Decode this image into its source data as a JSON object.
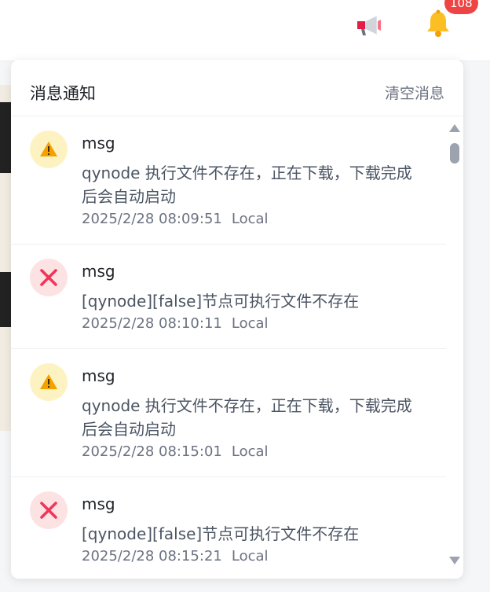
{
  "topbar": {
    "megaphone_icon": "megaphone-icon",
    "bell_icon": "bell-icon",
    "badge_count": "108"
  },
  "panel": {
    "title": "消息通知",
    "clear_label": "清空消息"
  },
  "notifications": [
    {
      "level": "warning",
      "icon": "warning-icon",
      "title": "msg",
      "body": "qynode 执行文件不存在，正在下载，下载完成后会自动启动",
      "time": "2025/2/28 08:09:51",
      "source": "Local"
    },
    {
      "level": "error",
      "icon": "error-icon",
      "title": "msg",
      "body": "[qynode][false]节点可执行文件不存在",
      "time": "2025/2/28 08:10:11",
      "source": "Local"
    },
    {
      "level": "warning",
      "icon": "warning-icon",
      "title": "msg",
      "body": "qynode 执行文件不存在，正在下载，下载完成后会自动启动",
      "time": "2025/2/28 08:15:01",
      "source": "Local"
    },
    {
      "level": "error",
      "icon": "error-icon",
      "title": "msg",
      "body": "[qynode][false]节点可执行文件不存在",
      "time": "2025/2/28 08:15:21",
      "source": "Local"
    }
  ],
  "colors": {
    "warning_bg": "#fdf3c2",
    "warning_fg": "#f4a100",
    "error_bg": "#fde2e4",
    "error_fg": "#f0355a",
    "badge": "#ef4444"
  }
}
